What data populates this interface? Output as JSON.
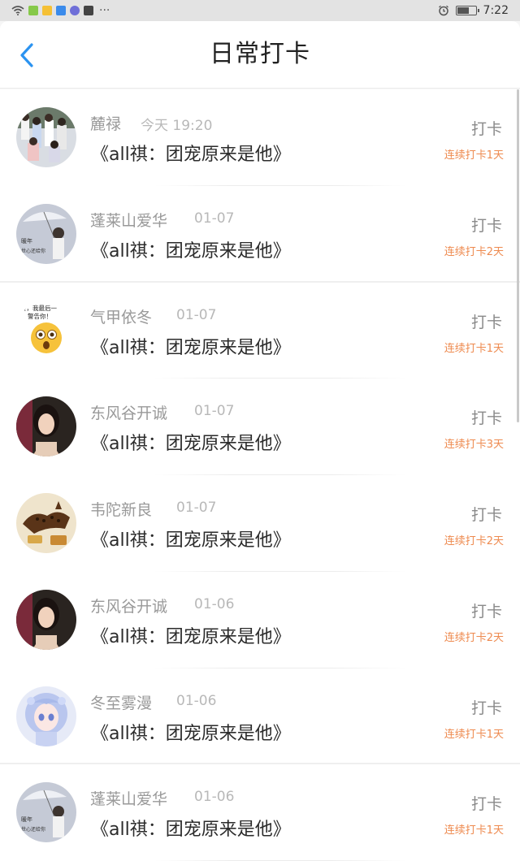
{
  "status_bar": {
    "time": "7:22",
    "more": "···",
    "battery_level": 0.7,
    "app_icon_colors": [
      "#86c94a",
      "#f5c035",
      "#3b8beb",
      "#6f6fd8",
      "#444444"
    ]
  },
  "header": {
    "title": "日常打卡",
    "back_icon": "chevron-left-icon",
    "accent": "#2b93f0"
  },
  "entries": [
    {
      "name": "麓禄",
      "date": "今天 19:20",
      "book": "《all祺：团宠原来是他》",
      "checkin": "打卡",
      "streak": "连续打卡1天",
      "avatar": "group-photo"
    },
    {
      "name": "蓬莱山爱华",
      "date": "01-07",
      "book": "《all祺：团宠原来是他》",
      "checkin": "打卡",
      "streak": "连续打卡2天",
      "avatar": "girl-umbrella"
    },
    {
      "name": "气甲依冬",
      "date": "01-07",
      "book": "《all祺：团宠原来是他》",
      "checkin": "打卡",
      "streak": "连续打卡1天",
      "avatar": "emoji-face"
    },
    {
      "name": "东风谷开诚",
      "date": "01-07",
      "book": "《all祺：团宠原来是他》",
      "checkin": "打卡",
      "streak": "连续打卡3天",
      "avatar": "girl-portrait"
    },
    {
      "name": "韦陀新良",
      "date": "01-07",
      "book": "《all祺：团宠原来是他》",
      "checkin": "打卡",
      "streak": "连续打卡2天",
      "avatar": "bean-art"
    },
    {
      "name": "东风谷开诚",
      "date": "01-06",
      "book": "《all祺：团宠原来是他》",
      "checkin": "打卡",
      "streak": "连续打卡2天",
      "avatar": "girl-portrait"
    },
    {
      "name": "冬至雾漫",
      "date": "01-06",
      "book": "《all祺：团宠原来是他》",
      "checkin": "打卡",
      "streak": "连续打卡1天",
      "avatar": "anime-girl"
    },
    {
      "name": "蓬莱山爱华",
      "date": "01-06",
      "book": "《all祺：团宠原来是他》",
      "checkin": "打卡",
      "streak": "连续打卡1天",
      "avatar": "girl-umbrella"
    }
  ],
  "colors": {
    "streak": "#ee8a4f",
    "name": "#999999",
    "book": "#2b2b2b"
  }
}
